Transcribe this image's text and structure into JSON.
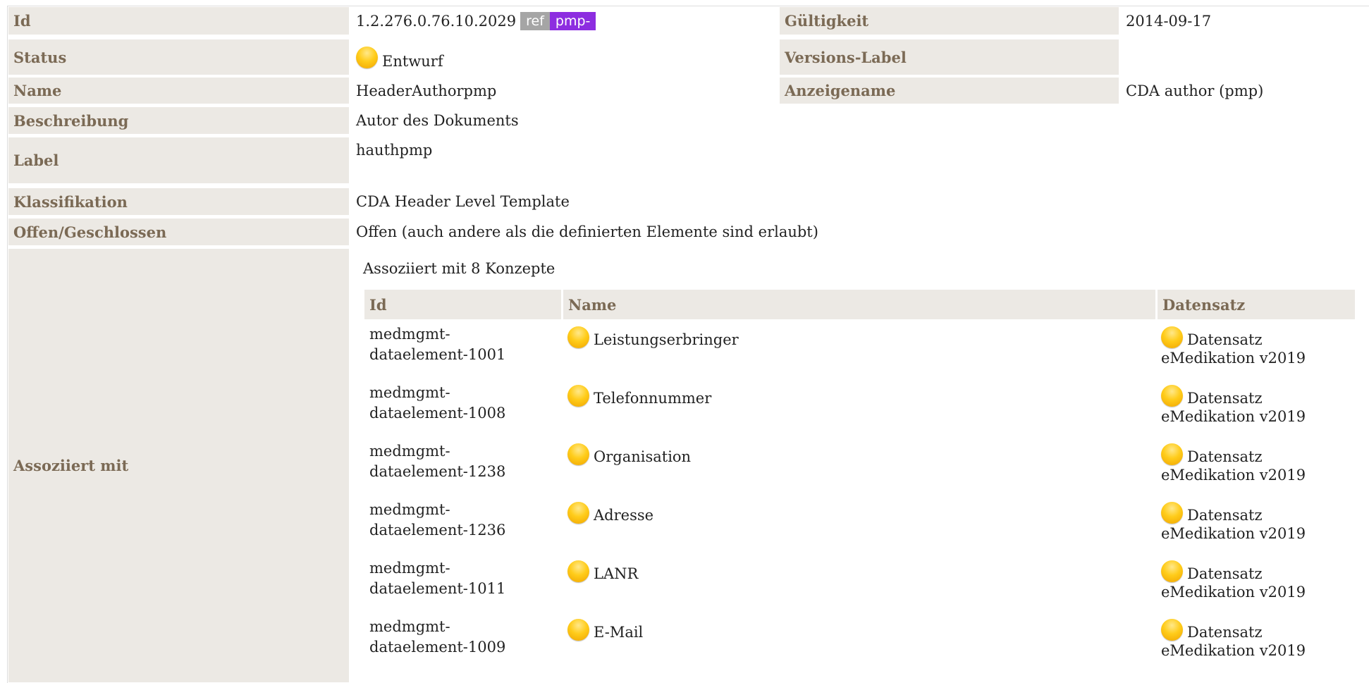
{
  "fields": {
    "id_label": "Id",
    "id_value": "1.2.276.0.76.10.2029",
    "id_badge_ref": "ref",
    "id_badge_pmp": "pmp-",
    "validity_label": "Gültigkeit",
    "validity_value": "2014-09-17",
    "status_label": "Status",
    "status_value": "Entwurf",
    "version_label": "Versions-Label",
    "name_label": "Name",
    "name_value": "HeaderAuthorpmp",
    "display_label": "Anzeigename",
    "display_value": "CDA author (pmp)",
    "description_label": "Beschreibung",
    "description_value": "Autor des Dokuments",
    "label_label": "Label",
    "label_value": "hauthpmp",
    "classification_label": "Klassifikation",
    "classification_value": "CDA Header Level Template",
    "open_label": "Offen/Geschlossen",
    "open_value": "Offen (auch andere als die definierten Elemente sind erlaubt)",
    "assoc_label": "Assoziiert mit"
  },
  "concepts": {
    "heading": "Assoziiert mit 8 Konzepte",
    "col_id": "Id",
    "col_name": "Name",
    "col_dataset": "Datensatz",
    "status_icon": "status-draft-icon",
    "status_color": "#ffcc1a",
    "rows": [
      {
        "id1": "medmgmt-",
        "id2": "dataelement-1001",
        "name": "Leistungserbringer",
        "ds1": "Datensatz",
        "ds2": "eMedikation v2019"
      },
      {
        "id1": "medmgmt-",
        "id2": "dataelement-1008",
        "name": "Telefonnummer",
        "ds1": "Datensatz",
        "ds2": "eMedikation v2019"
      },
      {
        "id1": "medmgmt-",
        "id2": "dataelement-1238",
        "name": "Organisation",
        "ds1": "Datensatz",
        "ds2": "eMedikation v2019"
      },
      {
        "id1": "medmgmt-",
        "id2": "dataelement-1236",
        "name": "Adresse",
        "ds1": "Datensatz",
        "ds2": "eMedikation v2019"
      },
      {
        "id1": "medmgmt-",
        "id2": "dataelement-1011",
        "name": "LANR",
        "ds1": "Datensatz",
        "ds2": "eMedikation v2019"
      },
      {
        "id1": "medmgmt-",
        "id2": "dataelement-1009",
        "name": "E-Mail",
        "ds1": "Datensatz",
        "ds2": "eMedikation v2019"
      }
    ]
  }
}
